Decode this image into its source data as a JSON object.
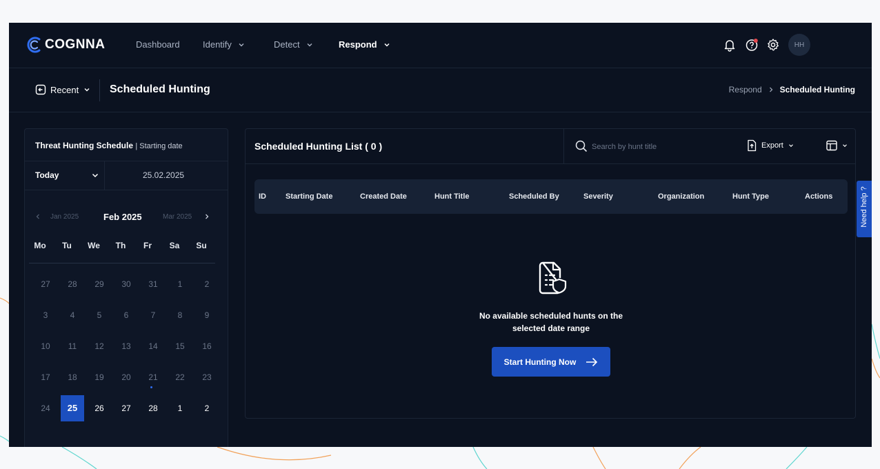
{
  "colors": {
    "app_background": "#0b1220",
    "panel_background": "#0e1626",
    "accent": "#1c4fbf",
    "border": "#1b2536"
  },
  "brand": {
    "logo_text": "COGNNA",
    "logo_icon": "cognna-logo-icon"
  },
  "topnav": {
    "items": [
      {
        "label": "Dashboard",
        "has_dropdown": false
      },
      {
        "label": "Identify",
        "has_dropdown": true
      },
      {
        "label": "Detect",
        "has_dropdown": true
      },
      {
        "label": "Respond",
        "has_dropdown": true,
        "active": true
      }
    ],
    "icons": [
      "bell-icon",
      "help-icon",
      "gear-icon"
    ],
    "avatar_initials": "HH"
  },
  "subheader": {
    "recent_label": "Recent",
    "page_title": "Scheduled Hunting",
    "breadcrumb": [
      "Respond",
      "Scheduled Hunting"
    ]
  },
  "schedule": {
    "title": "Threat Hunting Schedule",
    "subtitle": "| Starting date",
    "range_select": "Today",
    "date_value": "25.02.2025",
    "calendar": {
      "prev_month": "Jan 2025",
      "current_month": "Feb 2025",
      "next_month": "Mar 2025",
      "weekdays": [
        "Mo",
        "Tu",
        "We",
        "Th",
        "Fr",
        "Sa",
        "Su"
      ],
      "weeks": [
        [
          "27",
          "28",
          "29",
          "30",
          "31",
          "1",
          "2"
        ],
        [
          "3",
          "4",
          "5",
          "6",
          "7",
          "8",
          "9"
        ],
        [
          "10",
          "11",
          "12",
          "13",
          "14",
          "15",
          "16"
        ],
        [
          "17",
          "18",
          "19",
          "20",
          "21",
          "22",
          "23"
        ],
        [
          "24",
          "25",
          "26",
          "27",
          "28",
          "1",
          "2"
        ]
      ],
      "selected_day": "25",
      "today_marker_day": "21"
    }
  },
  "list": {
    "title": "Scheduled Hunting List",
    "count": "( 0 )",
    "search_placeholder": "Search by hunt title",
    "export_label": "Export",
    "columns": [
      "ID",
      "Starting Date",
      "Created Date",
      "Hunt Title",
      "Scheduled By",
      "Severity",
      "Organization",
      "Hunt Type",
      "Actions"
    ],
    "empty_message_line1": "No available scheduled hunts on the",
    "empty_message_line2": "selected date range",
    "cta_label": "Start Hunting Now"
  },
  "help_tab": {
    "label": "Need help ?"
  }
}
